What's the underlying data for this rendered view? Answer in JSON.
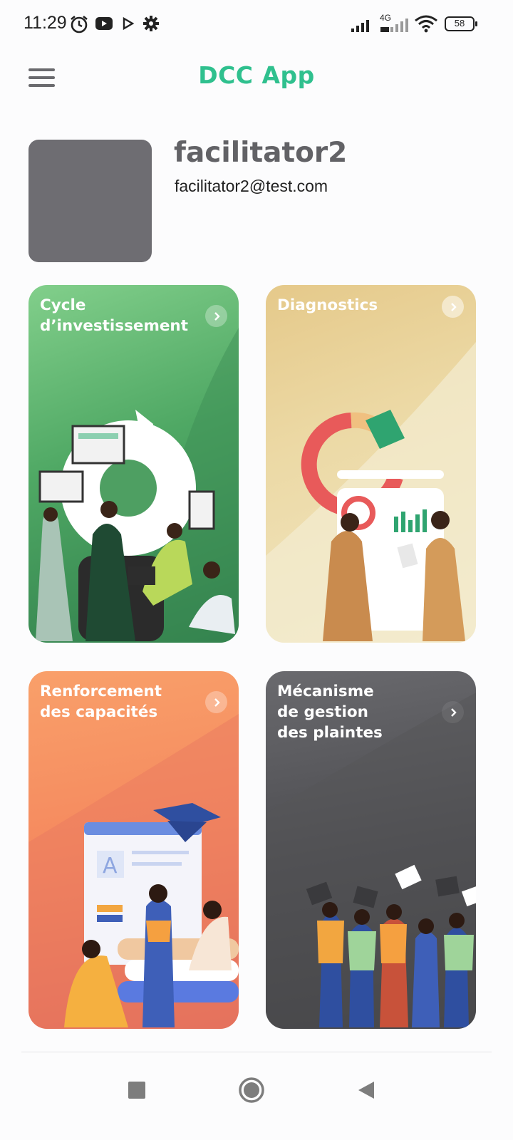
{
  "status_bar": {
    "time": "11:29",
    "battery": "58",
    "network": "4G"
  },
  "app_bar": {
    "title": "DCC App"
  },
  "profile": {
    "name": "facilitator2",
    "email": "facilitator2@test.com"
  },
  "cards": [
    {
      "title": "Cycle\nd’investissement"
    },
    {
      "title": "Diagnostics"
    },
    {
      "title": "Renforcement\ndes capacités"
    },
    {
      "title": "Mécanisme\nde gestion\ndes plaintes"
    }
  ],
  "colors": {
    "brand": "#2fc08e",
    "card_green": "#4fa864",
    "card_gold": "#e5c98a",
    "card_orange": "#f58a5f",
    "card_dark": "#4c4c50"
  },
  "icons": [
    "alarm-icon",
    "youtube-icon",
    "play-store-icon",
    "settings-icon",
    "signal-icon",
    "wifi-icon",
    "battery-icon",
    "menu-icon",
    "chevron-right-icon",
    "recents-icon",
    "home-icon",
    "back-icon"
  ]
}
